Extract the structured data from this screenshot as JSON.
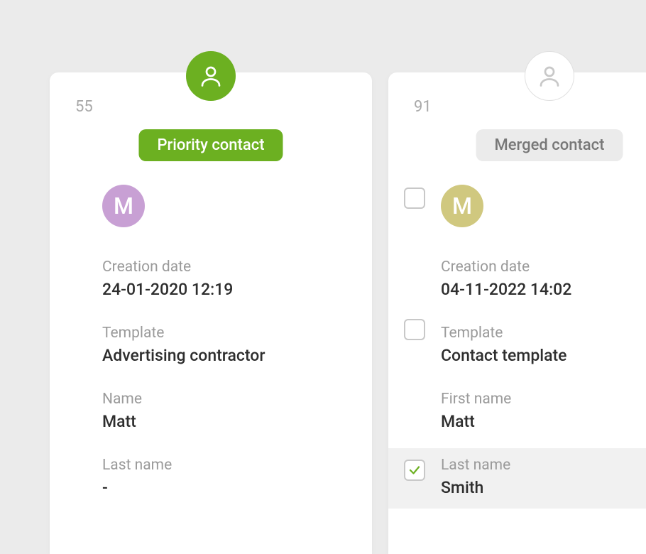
{
  "left": {
    "id": "55",
    "badge_label": "Priority contact",
    "avatar_initial": "M",
    "creation_date_label": "Creation date",
    "creation_date_value": "24-01-2020 12:19",
    "template_label": "Template",
    "template_value": "Advertising contractor",
    "name_label": "Name",
    "name_value": "Matt",
    "lastname_label": "Last name",
    "lastname_value": "-"
  },
  "right": {
    "id": "91",
    "badge_label": "Merged contact",
    "avatar_initial": "M",
    "creation_date_label": "Creation date",
    "creation_date_value": "04-11-2022 14:02",
    "template_label": "Template",
    "template_value": "Contact template",
    "firstname_label": "First name",
    "firstname_value": "Matt",
    "lastname_label": "Last name",
    "lastname_value": "Smith"
  }
}
